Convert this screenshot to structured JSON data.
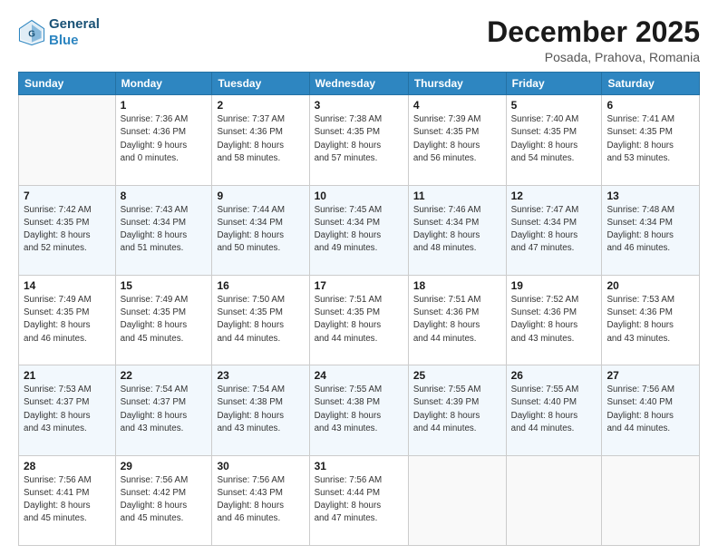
{
  "header": {
    "logo_line1": "General",
    "logo_line2": "Blue",
    "month": "December 2025",
    "location": "Posada, Prahova, Romania"
  },
  "weekdays": [
    "Sunday",
    "Monday",
    "Tuesday",
    "Wednesday",
    "Thursday",
    "Friday",
    "Saturday"
  ],
  "weeks": [
    [
      {
        "day": "",
        "info": ""
      },
      {
        "day": "1",
        "info": "Sunrise: 7:36 AM\nSunset: 4:36 PM\nDaylight: 9 hours\nand 0 minutes."
      },
      {
        "day": "2",
        "info": "Sunrise: 7:37 AM\nSunset: 4:36 PM\nDaylight: 8 hours\nand 58 minutes."
      },
      {
        "day": "3",
        "info": "Sunrise: 7:38 AM\nSunset: 4:35 PM\nDaylight: 8 hours\nand 57 minutes."
      },
      {
        "day": "4",
        "info": "Sunrise: 7:39 AM\nSunset: 4:35 PM\nDaylight: 8 hours\nand 56 minutes."
      },
      {
        "day": "5",
        "info": "Sunrise: 7:40 AM\nSunset: 4:35 PM\nDaylight: 8 hours\nand 54 minutes."
      },
      {
        "day": "6",
        "info": "Sunrise: 7:41 AM\nSunset: 4:35 PM\nDaylight: 8 hours\nand 53 minutes."
      }
    ],
    [
      {
        "day": "7",
        "info": "Sunrise: 7:42 AM\nSunset: 4:35 PM\nDaylight: 8 hours\nand 52 minutes."
      },
      {
        "day": "8",
        "info": "Sunrise: 7:43 AM\nSunset: 4:34 PM\nDaylight: 8 hours\nand 51 minutes."
      },
      {
        "day": "9",
        "info": "Sunrise: 7:44 AM\nSunset: 4:34 PM\nDaylight: 8 hours\nand 50 minutes."
      },
      {
        "day": "10",
        "info": "Sunrise: 7:45 AM\nSunset: 4:34 PM\nDaylight: 8 hours\nand 49 minutes."
      },
      {
        "day": "11",
        "info": "Sunrise: 7:46 AM\nSunset: 4:34 PM\nDaylight: 8 hours\nand 48 minutes."
      },
      {
        "day": "12",
        "info": "Sunrise: 7:47 AM\nSunset: 4:34 PM\nDaylight: 8 hours\nand 47 minutes."
      },
      {
        "day": "13",
        "info": "Sunrise: 7:48 AM\nSunset: 4:34 PM\nDaylight: 8 hours\nand 46 minutes."
      }
    ],
    [
      {
        "day": "14",
        "info": "Sunrise: 7:49 AM\nSunset: 4:35 PM\nDaylight: 8 hours\nand 46 minutes."
      },
      {
        "day": "15",
        "info": "Sunrise: 7:49 AM\nSunset: 4:35 PM\nDaylight: 8 hours\nand 45 minutes."
      },
      {
        "day": "16",
        "info": "Sunrise: 7:50 AM\nSunset: 4:35 PM\nDaylight: 8 hours\nand 44 minutes."
      },
      {
        "day": "17",
        "info": "Sunrise: 7:51 AM\nSunset: 4:35 PM\nDaylight: 8 hours\nand 44 minutes."
      },
      {
        "day": "18",
        "info": "Sunrise: 7:51 AM\nSunset: 4:36 PM\nDaylight: 8 hours\nand 44 minutes."
      },
      {
        "day": "19",
        "info": "Sunrise: 7:52 AM\nSunset: 4:36 PM\nDaylight: 8 hours\nand 43 minutes."
      },
      {
        "day": "20",
        "info": "Sunrise: 7:53 AM\nSunset: 4:36 PM\nDaylight: 8 hours\nand 43 minutes."
      }
    ],
    [
      {
        "day": "21",
        "info": "Sunrise: 7:53 AM\nSunset: 4:37 PM\nDaylight: 8 hours\nand 43 minutes."
      },
      {
        "day": "22",
        "info": "Sunrise: 7:54 AM\nSunset: 4:37 PM\nDaylight: 8 hours\nand 43 minutes."
      },
      {
        "day": "23",
        "info": "Sunrise: 7:54 AM\nSunset: 4:38 PM\nDaylight: 8 hours\nand 43 minutes."
      },
      {
        "day": "24",
        "info": "Sunrise: 7:55 AM\nSunset: 4:38 PM\nDaylight: 8 hours\nand 43 minutes."
      },
      {
        "day": "25",
        "info": "Sunrise: 7:55 AM\nSunset: 4:39 PM\nDaylight: 8 hours\nand 44 minutes."
      },
      {
        "day": "26",
        "info": "Sunrise: 7:55 AM\nSunset: 4:40 PM\nDaylight: 8 hours\nand 44 minutes."
      },
      {
        "day": "27",
        "info": "Sunrise: 7:56 AM\nSunset: 4:40 PM\nDaylight: 8 hours\nand 44 minutes."
      }
    ],
    [
      {
        "day": "28",
        "info": "Sunrise: 7:56 AM\nSunset: 4:41 PM\nDaylight: 8 hours\nand 45 minutes."
      },
      {
        "day": "29",
        "info": "Sunrise: 7:56 AM\nSunset: 4:42 PM\nDaylight: 8 hours\nand 45 minutes."
      },
      {
        "day": "30",
        "info": "Sunrise: 7:56 AM\nSunset: 4:43 PM\nDaylight: 8 hours\nand 46 minutes."
      },
      {
        "day": "31",
        "info": "Sunrise: 7:56 AM\nSunset: 4:44 PM\nDaylight: 8 hours\nand 47 minutes."
      },
      {
        "day": "",
        "info": ""
      },
      {
        "day": "",
        "info": ""
      },
      {
        "day": "",
        "info": ""
      }
    ]
  ]
}
